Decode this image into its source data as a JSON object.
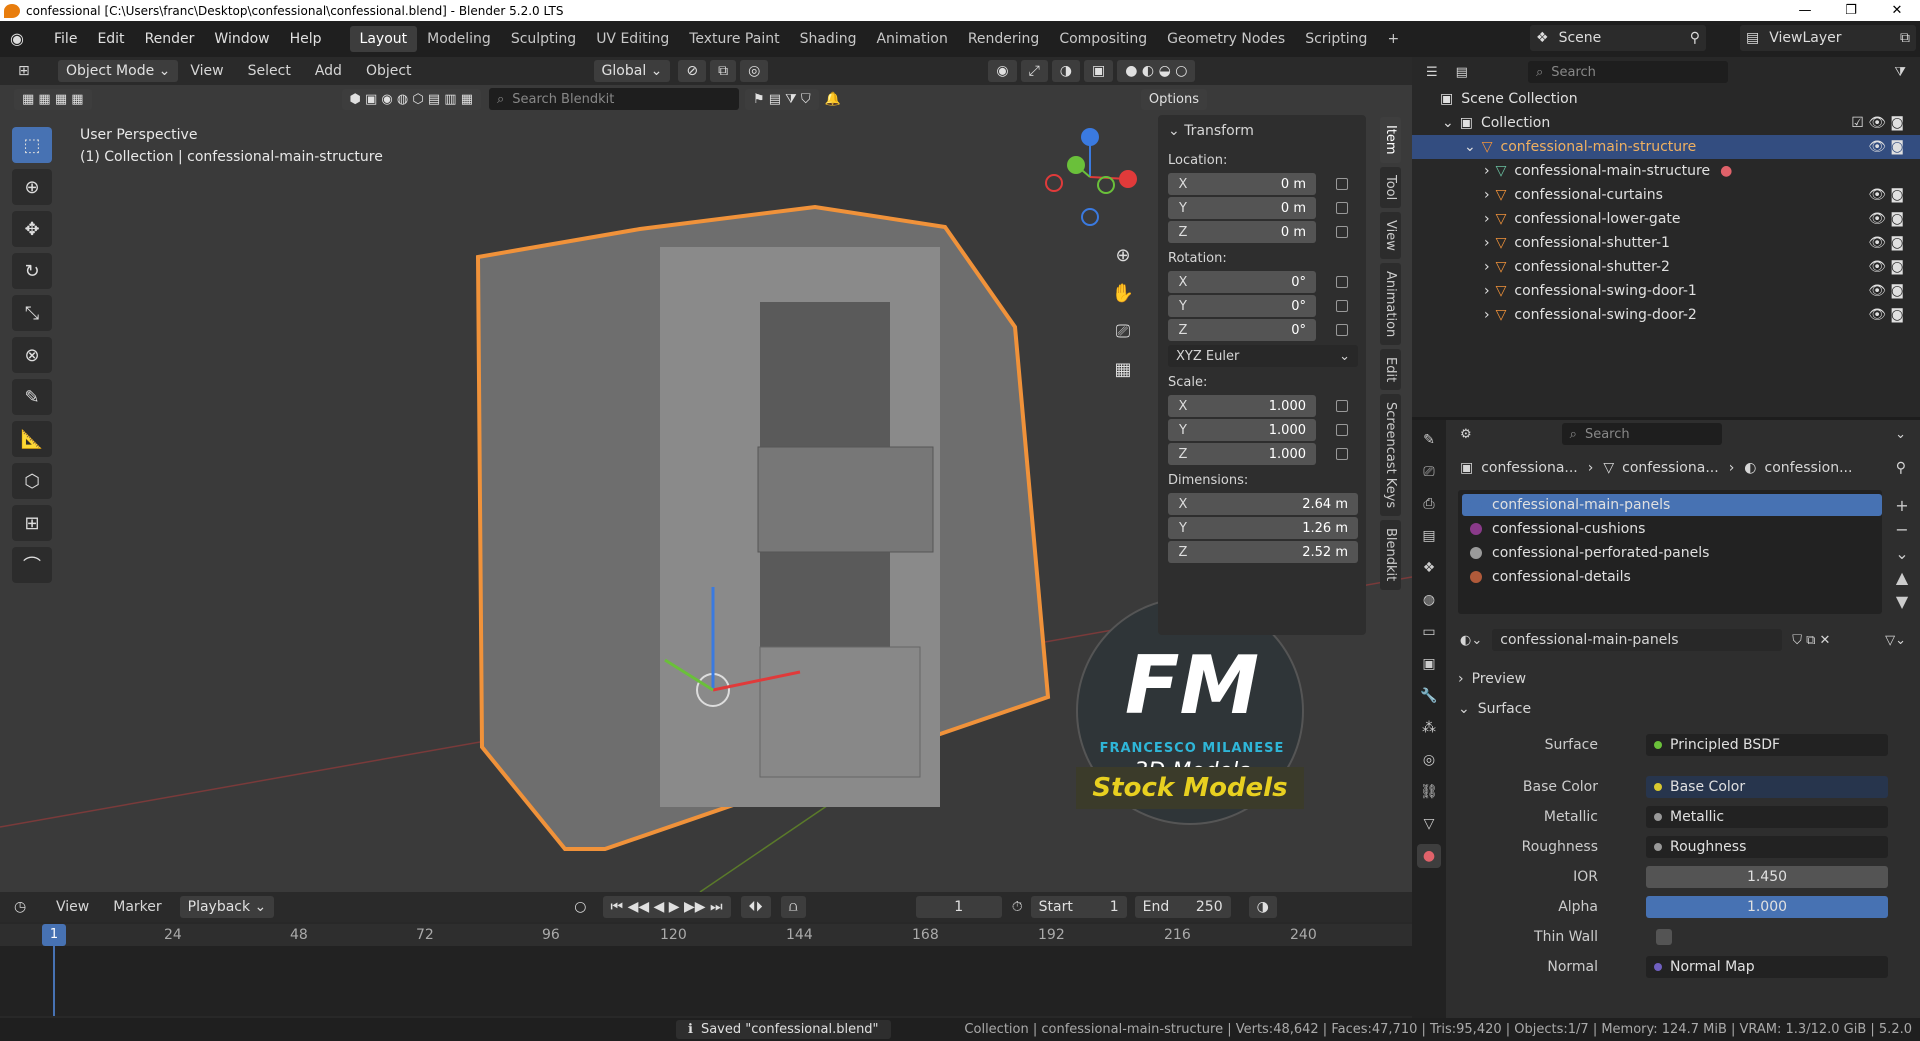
{
  "title": "confessional [C:\\Users\\franc\\Desktop\\confessional\\confessional.blend] - Blender 5.2.0 LTS",
  "menus": [
    "File",
    "Edit",
    "Render",
    "Window",
    "Help"
  ],
  "workspaces": [
    "Layout",
    "Modeling",
    "Sculpting",
    "UV Editing",
    "Texture Paint",
    "Shading",
    "Animation",
    "Rendering",
    "Compositing",
    "Geometry Nodes",
    "Scripting"
  ],
  "scene_label": "Scene",
  "viewlayer_label": "ViewLayer",
  "viewport": {
    "mode": "Object Mode",
    "menus": [
      "View",
      "Select",
      "Add",
      "Object"
    ],
    "orientation": "Global",
    "search_placeholder": "Search Blendkit",
    "options": "Options",
    "perspective": "User Perspective",
    "context": "(1) Collection | confessional-main-structure"
  },
  "npanel": {
    "title": "Transform",
    "location_label": "Location:",
    "rotation_label": "Rotation:",
    "scale_label": "Scale:",
    "dimensions_label": "Dimensions:",
    "loc": [
      "0 m",
      "0 m",
      "0 m"
    ],
    "rot": [
      "0°",
      "0°",
      "0°"
    ],
    "euler": "XYZ Euler",
    "scale": [
      "1.000",
      "1.000",
      "1.000"
    ],
    "dims": [
      "2.64 m",
      "1.26 m",
      "2.52 m"
    ],
    "axes": [
      "X",
      "Y",
      "Z"
    ]
  },
  "vtabs": [
    "Item",
    "Tool",
    "View",
    "Animation",
    "Edit",
    "Screencast Keys",
    "Blendkit"
  ],
  "watermark": {
    "logo": "FM",
    "name": "FRANCESCO MILANESE",
    "sub": "3D Models",
    "stock": "Stock Models"
  },
  "timeline": {
    "menus": [
      "View",
      "Marker",
      "Playback"
    ],
    "frame": "1",
    "start_label": "Start",
    "start": "1",
    "end_label": "End",
    "end": "250",
    "ticks": [
      "1",
      "24",
      "48",
      "72",
      "96",
      "120",
      "144",
      "168",
      "192",
      "216",
      "240"
    ]
  },
  "status": {
    "saved": "Saved \"confessional.blend\"",
    "info": "Collection | confessional-main-structure | Verts:48,642 | Faces:47,710 | Tris:95,420 | Objects:1/7 | Memory: 124.7 MiB | VRAM: 1.3/12.0 GiB | 5.2.0"
  },
  "outliner": {
    "search_placeholder": "Search",
    "scene_collection": "Scene Collection",
    "collection": "Collection",
    "items": [
      "confessional-main-structure",
      "confessional-main-structure",
      "confessional-curtains",
      "confessional-lower-gate",
      "confessional-shutter-1",
      "confessional-shutter-2",
      "confessional-swing-door-1",
      "confessional-swing-door-2"
    ]
  },
  "props": {
    "search_placeholder": "Search",
    "crumbs": [
      "confessiona...",
      "confessiona...",
      "confession..."
    ],
    "materials": [
      "confessional-main-panels",
      "confessional-cushions",
      "confessional-perforated-panels",
      "confessional-details"
    ],
    "material_name": "confessional-main-panels",
    "preview": "Preview",
    "surface_panel": "Surface",
    "rows": [
      {
        "label": "Surface",
        "value": "Principled BSDF"
      },
      {
        "label": "Base Color",
        "value": "Base Color"
      },
      {
        "label": "Metallic",
        "value": "Metallic"
      },
      {
        "label": "Roughness",
        "value": "Roughness"
      },
      {
        "label": "IOR",
        "value": "1.450"
      },
      {
        "label": "Alpha",
        "value": "1.000"
      },
      {
        "label": "Thin Wall",
        "value": ""
      },
      {
        "label": "Normal",
        "value": "Normal Map"
      }
    ]
  }
}
